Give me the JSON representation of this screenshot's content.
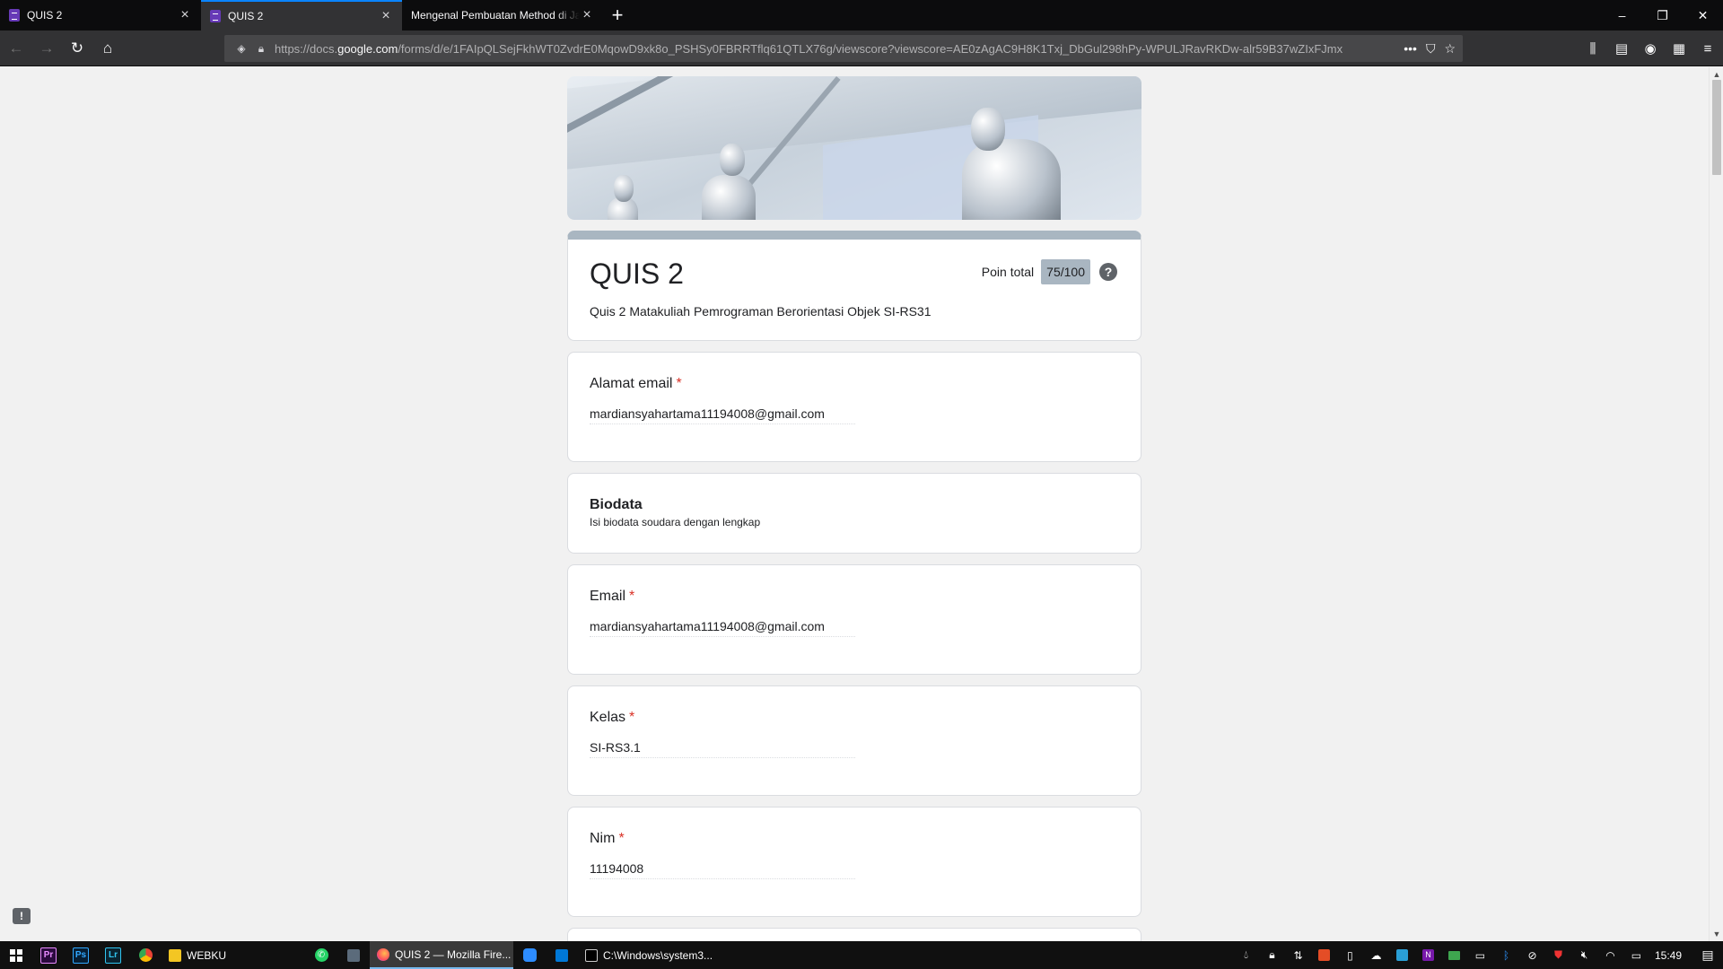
{
  "browser": {
    "tabs": [
      {
        "title": "QUIS 2",
        "active": false
      },
      {
        "title": "QUIS 2",
        "active": true
      },
      {
        "title": "Mengenal Pembuatan Method di Ja",
        "active": false
      }
    ],
    "url_prefix": "https://docs.",
    "url_host": "google.com",
    "url_path": "/forms/d/e/1FAIpQLSejFkhWT0ZvdrE0MqowD9xk8o_PSHSy0FBRRTflq61QTLX76g/viewscore?viewscore=AE0zAgAC9H8K1Txj_DbGul298hPy-WPULJRavRKDw-alr59B37wZIxFJmx"
  },
  "form": {
    "title": "QUIS 2",
    "description": "Quis 2 Matakuliah Pemrograman Berorientasi Objek SI-RS31",
    "score_label": "Poin total",
    "score_value": "75/100",
    "required_mark": "*",
    "questions": [
      {
        "label": "Alamat email",
        "answer": "mardiansyahartama11194008@gmail.com"
      },
      {
        "label": "Email",
        "answer": "mardiansyahartama11194008@gmail.com"
      },
      {
        "label": "Kelas",
        "answer": "SI-RS3.1"
      },
      {
        "label": "Nim",
        "answer": "11194008"
      }
    ],
    "section": {
      "title": "Biodata",
      "description": "Isi biodata soudara dengan lengkap"
    }
  },
  "taskbar": {
    "apps": [
      {
        "label": "WEBKU"
      },
      {
        "label": "QUIS 2 — Mozilla Fire...",
        "active": true
      },
      {
        "label": "C:\\Windows\\system3..."
      }
    ],
    "clock": "15:49"
  },
  "colors": {
    "accent": "#a9b6c1",
    "required": "#d93025",
    "firefox_active_tab": "#0a84ff"
  }
}
